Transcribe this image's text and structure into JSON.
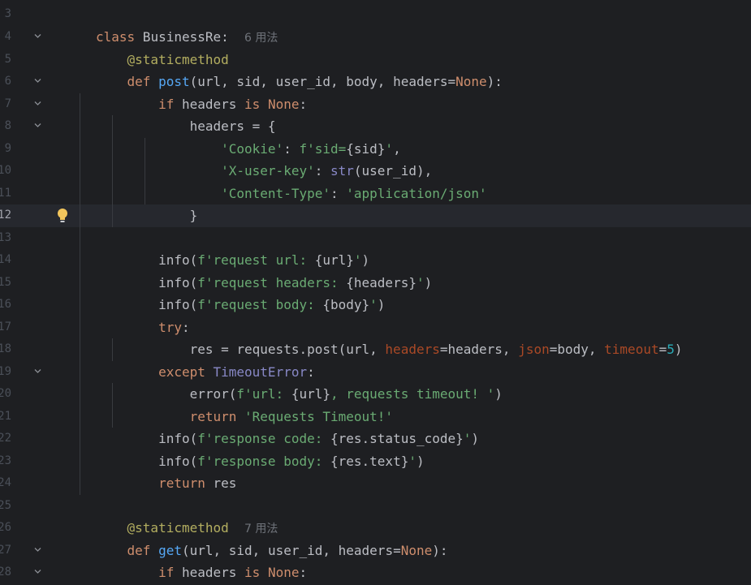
{
  "editor": {
    "current_line": "12",
    "line_numbers": [
      "3",
      "4",
      "5",
      "6",
      "7",
      "8",
      "9",
      "10",
      "11",
      "12",
      "13",
      "14",
      "15",
      "16",
      "17",
      "18",
      "19",
      "20",
      "21",
      "22",
      "23",
      "24",
      "25",
      "26",
      "27",
      "28"
    ],
    "usage_hint_1": "6 用法",
    "usage_hint_2": "7 用法",
    "icons": {
      "fold": "chevron-down-icon",
      "intention": "lightbulb-icon"
    },
    "colors": {
      "background": "#1e1f22",
      "current_line": "#26282e",
      "keyword": "#cf8e6d",
      "function": "#56a8f5",
      "string": "#6aab73",
      "decorator": "#b3ae60",
      "builtin": "#8888c6",
      "number": "#2aacb8",
      "param": "#aa4926",
      "default": "#bcbec4"
    }
  }
}
